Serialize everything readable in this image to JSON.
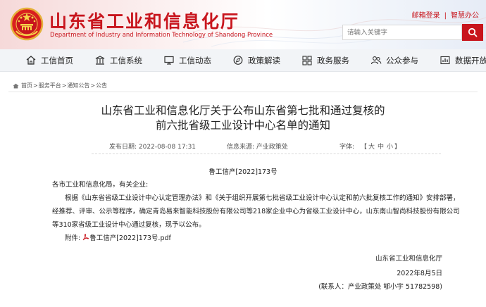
{
  "header": {
    "title": "山东省工业和信息化厅",
    "subtitle": "Department of Industry and Information Technology of Shandong Province",
    "links": [
      "邮箱登录",
      "智慧办公"
    ],
    "search_placeholder": "请输入关键字"
  },
  "nav": [
    {
      "label": "工信首页",
      "icon": "home-icon"
    },
    {
      "label": "工信系统",
      "icon": "building-icon"
    },
    {
      "label": "工信动态",
      "icon": "monitor-icon"
    },
    {
      "label": "政策解读",
      "icon": "compass-icon"
    },
    {
      "label": "政务服务",
      "icon": "grid-icon"
    },
    {
      "label": "公众参与",
      "icon": "people-icon"
    },
    {
      "label": "数据开放",
      "icon": "chart-icon"
    }
  ],
  "breadcrumb": [
    "首页",
    "服务平台",
    "通知公告",
    "公告"
  ],
  "article": {
    "title_line1": "山东省工业和信息化厅关于公布山东省第七批和通过复核的",
    "title_line2": "前六批省级工业设计中心名单的通知",
    "date_label": "发布日期:",
    "date": "2022-08-08 17:31",
    "source_label": "信息来源:",
    "source": "产业政策处",
    "font_label": "字体:",
    "font_sizes": [
      "大",
      "中",
      "小"
    ],
    "doc_no": "鲁工信产[2022]173号",
    "salutation": "各市工业和信息化局，有关企业:",
    "para1_line1": "根据《山东省省级工业设计中心认定管理办法》和《关于组织开展第七批省级工业设计中心认定和前六批复核工作的通知》安排部署，",
    "para1_line2": "经推荐、评审、公示等程序，确定青岛易来智能科技股份有限公司等218家企业中心为省级工业设计中心，山东南山智尚科技股份有限公司",
    "para1_line3": "等310家省级工业设计中心通过复核，现予以公布。",
    "attachment_label": "附件:",
    "attachment": "鲁工信产[2022]173号.pdf",
    "sign_org": "山东省工业和信息化厅",
    "sign_date": "2022年8月5日",
    "contact": "(联系人：产业政策处 郇小宇 51782598)"
  },
  "colors": {
    "brand_red": "#c8151d",
    "nav_bg": "#f2f4f7"
  }
}
